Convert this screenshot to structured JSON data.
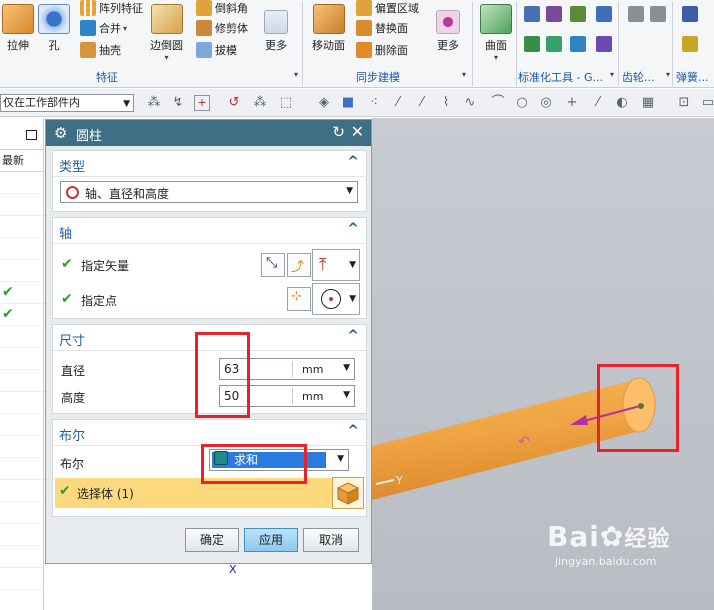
{
  "ribbon": {
    "items": [
      {
        "id": "extrude",
        "label": "拉伸",
        "icon": "extrude-icon"
      },
      {
        "id": "hole",
        "label": "孔",
        "icon": "hole-icon"
      },
      {
        "id": "pattern",
        "label": "阵列特征",
        "icon": "pattern-icon"
      },
      {
        "id": "unite",
        "label": "合并",
        "icon": "unite-icon"
      },
      {
        "id": "shell",
        "label": "抽壳",
        "icon": "shell-icon"
      },
      {
        "id": "edge_blend",
        "label": "边倒圆",
        "icon": "edge-blend-icon"
      },
      {
        "id": "chamfer",
        "label": "倒斜角",
        "icon": "chamfer-icon"
      },
      {
        "id": "trim_body",
        "label": "修剪体",
        "icon": "trim-body-icon"
      },
      {
        "id": "draft",
        "label": "拔模",
        "icon": "draft-icon"
      },
      {
        "id": "more1",
        "label": "更多",
        "icon": "more-icon"
      },
      {
        "id": "move_face",
        "label": "移动面",
        "icon": "move-face-icon"
      },
      {
        "id": "offset_region",
        "label": "偏置区域",
        "icon": "offset-region-icon"
      },
      {
        "id": "replace_face",
        "label": "替换面",
        "icon": "replace-face-icon"
      },
      {
        "id": "delete_face",
        "label": "删除面",
        "icon": "delete-face-icon"
      },
      {
        "id": "more2",
        "label": "更多",
        "icon": "more-icon"
      },
      {
        "id": "surface",
        "label": "曲面",
        "icon": "surface-icon"
      }
    ],
    "groups": [
      "特征",
      "同步建模",
      "标准化工具 - G...",
      "齿轮...",
      "弹簧..."
    ]
  },
  "selbar": {
    "filter": "仅在工作部件内"
  },
  "nav": {
    "column": "最新",
    "checks": [
      false,
      false,
      false,
      false,
      false,
      true,
      true,
      false,
      false,
      false,
      false,
      false,
      false,
      false,
      false,
      false,
      false,
      false,
      false,
      false
    ]
  },
  "dialog": {
    "title": "圆柱",
    "type": {
      "header": "类型",
      "value": "轴、直径和高度"
    },
    "axis": {
      "header": "轴",
      "vector_label": "指定矢量",
      "point_label": "指定点"
    },
    "dims": {
      "header": "尺寸",
      "diameter_label": "直径",
      "diameter_value": "63",
      "diameter_unit": "mm",
      "height_label": "高度",
      "height_value": "50",
      "height_unit": "mm"
    },
    "boolean": {
      "header": "布尔",
      "label": "布尔",
      "value": "求和",
      "select_body": "选择体 (1)"
    },
    "buttons": {
      "ok": "确定",
      "apply": "应用",
      "cancel": "取消"
    }
  },
  "viewport": {
    "axis_y": "Y",
    "axis_x": "X"
  },
  "watermark": {
    "brand": "Bai",
    "brand2": "经验",
    "url": "jingyan.baidu.com"
  }
}
